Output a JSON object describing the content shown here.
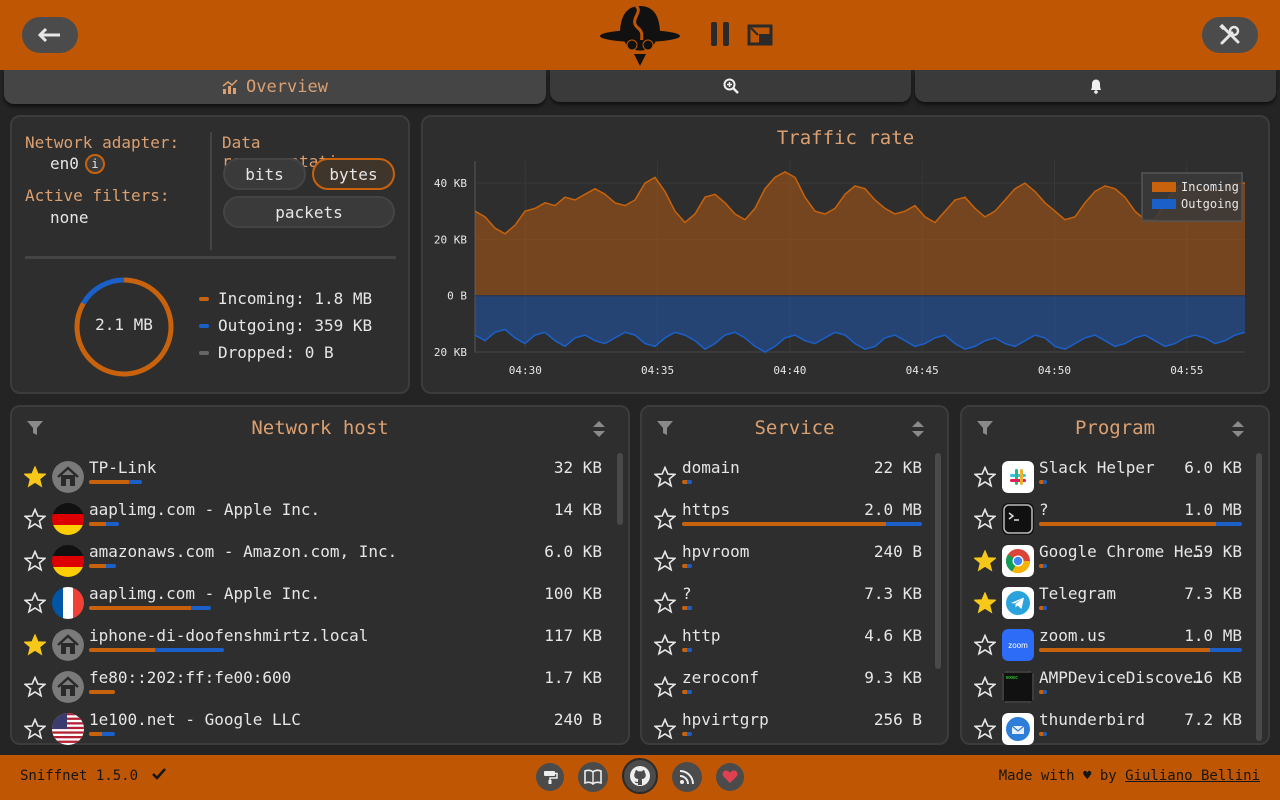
{
  "tabs": [
    {
      "label": "Overview",
      "icon": "chart-icon",
      "active": true
    },
    {
      "label": "",
      "icon": "zoom-in-icon",
      "active": false
    },
    {
      "label": "",
      "icon": "bell-icon",
      "active": false
    }
  ],
  "info": {
    "adapter_label": "Network adapter:",
    "adapter_value": "en0",
    "adapter_info_icon": "i",
    "filters_label": "Active filters:",
    "filters_value": "none",
    "representation_label": "Data representation:",
    "representation_options": [
      "bits",
      "bytes",
      "packets"
    ],
    "representation_selected": "bytes",
    "total": "2.1 MB",
    "incoming": "Incoming: 1.8 MB",
    "outgoing": "Outgoing: 359 KB",
    "dropped": "Dropped: 0 B",
    "incoming_fraction": 0.834
  },
  "colors": {
    "accent": "#bf5604",
    "incoming": "#c9620c",
    "outgoing": "#1b60c9",
    "dropped": "#666666",
    "favorite": "#f7c81a"
  },
  "chart_data": {
    "type": "area",
    "title": "Traffic rate",
    "xlabel": "",
    "ylabel": "",
    "ylim": [
      -20,
      45
    ],
    "yticks": [
      "40 KB",
      "20 KB",
      "0 B",
      "20 KB"
    ],
    "xticks": [
      "04:30",
      "04:35",
      "04:40",
      "04:45",
      "04:50",
      "04:55"
    ],
    "x_minutes_range": [
      28.1,
      57.2
    ],
    "legend": [
      "Incoming",
      "Outgoing"
    ],
    "legend_position": "top-right",
    "grid": true,
    "series": [
      {
        "name": "Incoming",
        "values": [
          30,
          28,
          24,
          22,
          25,
          30,
          31,
          33,
          32,
          35,
          34,
          36,
          38,
          36,
          33,
          32,
          34,
          40,
          42,
          37,
          30,
          26,
          29,
          35,
          36,
          33,
          29,
          27,
          31,
          38,
          42,
          44,
          42,
          35,
          30,
          29,
          31,
          36,
          39,
          38,
          34,
          31,
          29,
          30,
          32,
          28,
          26,
          30,
          34,
          35,
          31,
          28,
          30,
          34,
          38,
          40,
          37,
          33,
          30,
          27,
          28,
          33,
          37,
          39,
          38,
          35,
          30,
          27,
          27,
          33,
          38,
          40,
          39,
          38,
          37,
          39,
          40,
          40
        ]
      },
      {
        "name": "Outgoing",
        "values": [
          -14,
          -16,
          -13,
          -12,
          -15,
          -17,
          -14,
          -13,
          -16,
          -18,
          -15,
          -14,
          -16,
          -17,
          -15,
          -13,
          -14,
          -17,
          -18,
          -15,
          -13,
          -14,
          -16,
          -19,
          -17,
          -14,
          -13,
          -15,
          -18,
          -20,
          -18,
          -15,
          -14,
          -16,
          -17,
          -15,
          -13,
          -14,
          -17,
          -19,
          -18,
          -15,
          -14,
          -16,
          -18,
          -17,
          -15,
          -14,
          -17,
          -19,
          -18,
          -16,
          -15,
          -17,
          -18,
          -16,
          -14,
          -15,
          -18,
          -19,
          -17,
          -15,
          -14,
          -16,
          -18,
          -17,
          -15,
          -14,
          -16,
          -18,
          -17,
          -15,
          -14,
          -15,
          -17,
          -16,
          -14,
          -13
        ]
      }
    ]
  },
  "hosts": {
    "title": "Network host",
    "rows": [
      {
        "name": "TP-Link",
        "amount": "32 KB",
        "icon": "home-icon",
        "favorite": true,
        "in": 0.12,
        "out": 0.04
      },
      {
        "name": "aaplimg.com - Apple Inc.",
        "amount": "14 KB",
        "icon": "flag-de-icon",
        "favorite": false,
        "in": 0.05,
        "out": 0.04
      },
      {
        "name": "amazonaws.com - Amazon.com, Inc.",
        "amount": "6.0 KB",
        "icon": "flag-de-icon",
        "favorite": false,
        "in": 0.05,
        "out": 0.03
      },
      {
        "name": "aaplimg.com - Apple Inc.",
        "amount": "100 KB",
        "icon": "flag-fr-icon",
        "favorite": false,
        "in": 0.31,
        "out": 0.06
      },
      {
        "name": "iphone-di-doofenshmirtz.local",
        "amount": "117 KB",
        "icon": "home-icon",
        "favorite": true,
        "in": 0.2,
        "out": 0.21
      },
      {
        "name": "fe80::202:ff:fe00:600",
        "amount": "1.7 KB",
        "icon": "home-icon",
        "favorite": false,
        "in": 0.08,
        "out": 0.0
      },
      {
        "name": "1e100.net - Google LLC",
        "amount": "240 B",
        "icon": "flag-us-icon",
        "favorite": false,
        "in": 0.04,
        "out": 0.04
      }
    ]
  },
  "services": {
    "title": "Service",
    "rows": [
      {
        "name": "domain",
        "amount": "22 KB",
        "favorite": false,
        "in": 0.02,
        "out": 0.02
      },
      {
        "name": "https",
        "amount": "2.0 MB",
        "favorite": false,
        "in": 0.85,
        "out": 0.15
      },
      {
        "name": "hpvroom",
        "amount": "240 B",
        "favorite": false,
        "in": 0.02,
        "out": 0.02
      },
      {
        "name": "?",
        "amount": "7.3 KB",
        "favorite": false,
        "in": 0.02,
        "out": 0.02
      },
      {
        "name": "http",
        "amount": "4.6 KB",
        "favorite": false,
        "in": 0.02,
        "out": 0.02
      },
      {
        "name": "zeroconf",
        "amount": "9.3 KB",
        "favorite": false,
        "in": 0.02,
        "out": 0.02
      },
      {
        "name": "hpvirtgrp",
        "amount": "256 B",
        "favorite": false,
        "in": 0.02,
        "out": 0.02
      }
    ]
  },
  "programs": {
    "title": "Program",
    "rows": [
      {
        "name": "Slack Helper",
        "amount": "6.0 KB",
        "icon": "slack-icon",
        "favorite": false,
        "in": 0.02,
        "out": 0.02
      },
      {
        "name": "?",
        "amount": "1.0 MB",
        "icon": "terminal-icon",
        "favorite": false,
        "in": 0.87,
        "out": 0.13
      },
      {
        "name": "Google Chrome He…",
        "amount": "59 KB",
        "icon": "chrome-icon",
        "favorite": true,
        "in": 0.02,
        "out": 0.02
      },
      {
        "name": "Telegram",
        "amount": "7.3 KB",
        "icon": "telegram-icon",
        "favorite": true,
        "in": 0.02,
        "out": 0.02
      },
      {
        "name": "zoom.us",
        "amount": "1.0 MB",
        "icon": "zoom-icon",
        "favorite": false,
        "in": 0.84,
        "out": 0.16
      },
      {
        "name": "AMPDeviceDiscove…",
        "amount": "16 KB",
        "icon": "exec-icon",
        "favorite": false,
        "in": 0.02,
        "out": 0.02
      },
      {
        "name": "thunderbird",
        "amount": "7.2 KB",
        "icon": "thunderbird-icon",
        "favorite": false,
        "in": 0.02,
        "out": 0.02
      }
    ]
  },
  "footer": {
    "version": "Sniffnet 1.5.0",
    "made_with": "Made with ♥ by",
    "author": "Giuliano Bellini",
    "buttons": [
      "paint-roller-icon",
      "book-icon",
      "github-icon",
      "rss-icon",
      "heart-icon"
    ]
  }
}
